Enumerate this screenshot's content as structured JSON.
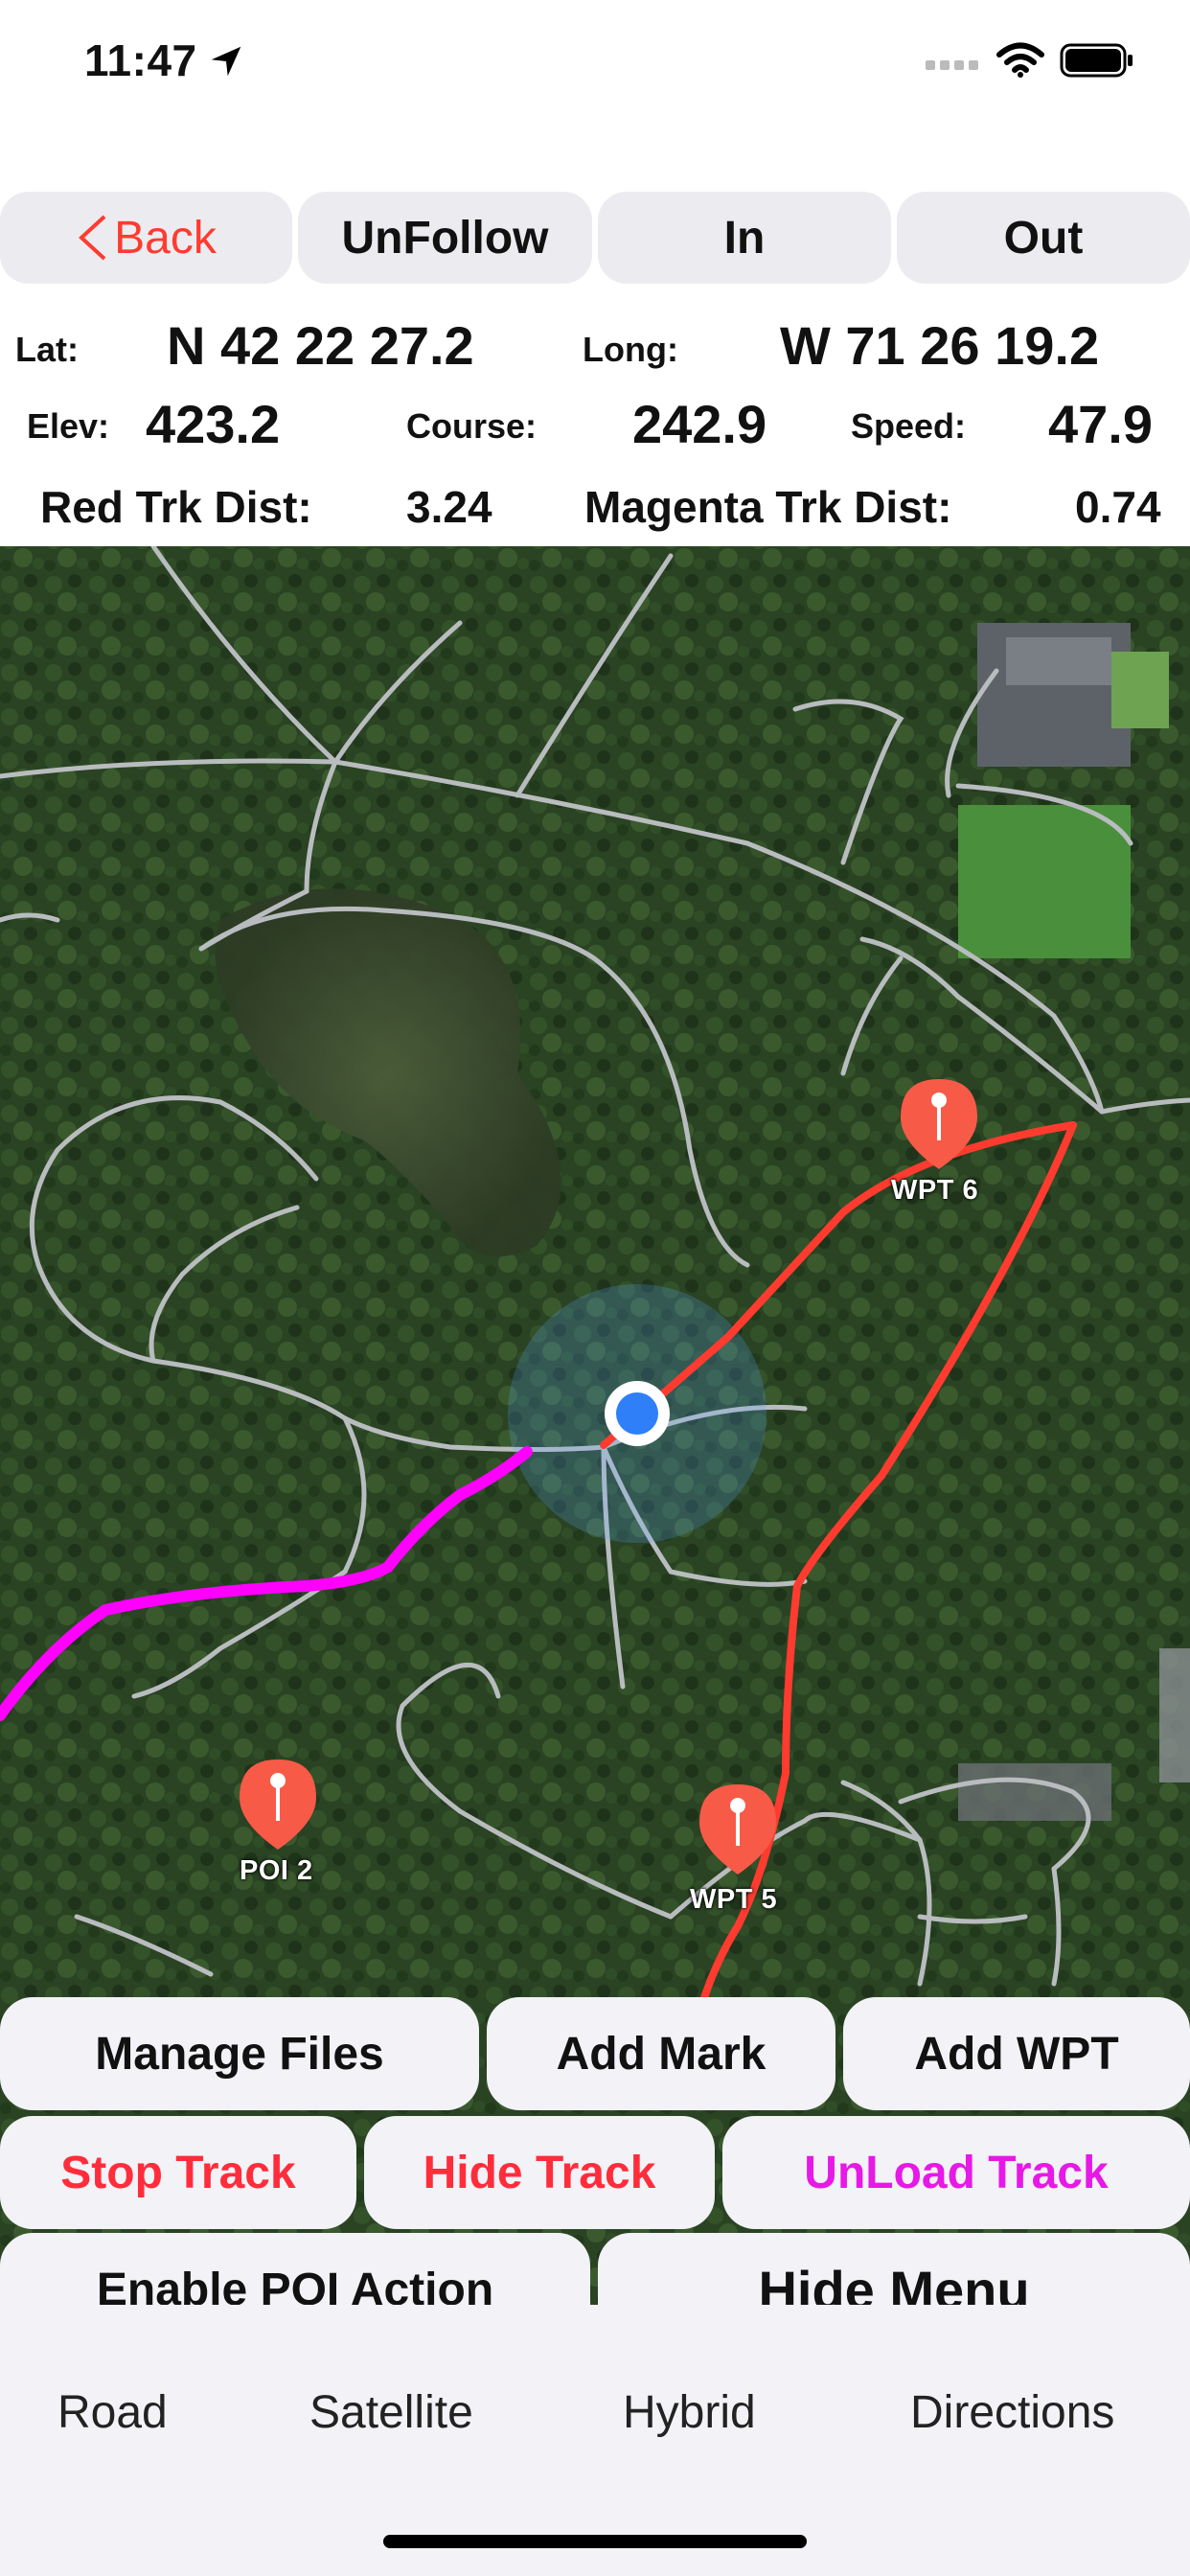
{
  "status_bar": {
    "time": "11:47"
  },
  "top_buttons": {
    "back": "Back",
    "unfollow": "UnFollow",
    "zoom_in": "In",
    "zoom_out": "Out"
  },
  "info": {
    "lat_label": "Lat:",
    "lat_value": "N 42 22 27.2",
    "long_label": "Long:",
    "long_value": "W 71 26 19.2",
    "elev_label": "Elev:",
    "elev_value": "423.2",
    "course_label": "Course:",
    "course_value": "242.9",
    "speed_label": "Speed:",
    "speed_value": "47.9",
    "red_trk_label": "Red Trk Dist:",
    "red_trk_value": "3.24",
    "magenta_trk_label": "Magenta Trk Dist:",
    "magenta_trk_value": "0.74"
  },
  "map": {
    "pins": [
      {
        "label": "WPT 6"
      },
      {
        "label": "POI 2"
      },
      {
        "label": "WPT 5"
      }
    ],
    "colors": {
      "red_track": "#ff3b30",
      "magenta_track": "#ff00ff",
      "pin": "#f85a48",
      "location_dot": "#2f7ff8"
    }
  },
  "menu": {
    "manage_files": "Manage Files",
    "add_mark": "Add Mark",
    "add_wpt": "Add WPT",
    "stop_track": "Stop Track",
    "hide_track": "Hide Track",
    "unload_track": "UnLoad Track",
    "enable_poi": "Enable POI Action",
    "hide_menu": "Hide Menu",
    "colors": {
      "red": "#ff2d3b",
      "magenta": "#e619e6"
    }
  },
  "map_types": {
    "road": "Road",
    "satellite": "Satellite",
    "hybrid": "Hybrid",
    "directions": "Directions"
  }
}
